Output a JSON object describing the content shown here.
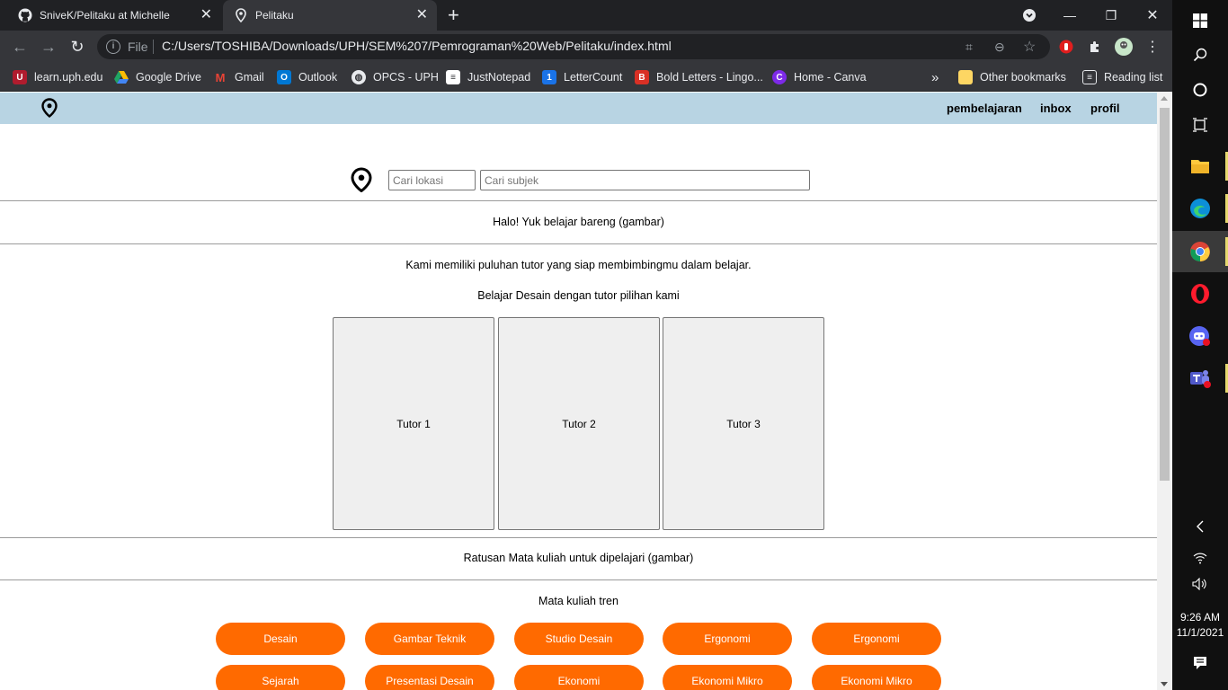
{
  "browser": {
    "tabs": [
      {
        "title": "SniveK/Pelitaku at Michelle",
        "icon": "github-icon"
      },
      {
        "title": "Pelitaku",
        "icon": "location-pin-icon"
      }
    ],
    "address": {
      "scheme_label": "File",
      "url": "C:/Users/TOSHIBA/Downloads/UPH/SEM%207/Pemrograman%20Web/Pelitaku/index.html"
    },
    "bookmarks": [
      {
        "label": "learn.uph.edu",
        "color": "#b01c2e"
      },
      {
        "label": "Google Drive",
        "color": "#1fa463"
      },
      {
        "label": "Gmail",
        "color": "#ea4335"
      },
      {
        "label": "Outlook",
        "color": "#0078d4"
      },
      {
        "label": "OPCS - UPH",
        "color": "#5f6368"
      },
      {
        "label": "JustNotepad",
        "color": "#ffffff"
      },
      {
        "label": "LetterCount",
        "color": "#1a73e8"
      },
      {
        "label": "Bold Letters - Lingo...",
        "color": "#d93025"
      },
      {
        "label": "Home - Canva",
        "color": "#7d2ae8"
      }
    ],
    "overflow_label": "»",
    "other_bookmarks": "Other bookmarks",
    "reading_list": "Reading list"
  },
  "site": {
    "nav": {
      "links": [
        "pembelajaran",
        "inbox",
        "profil"
      ]
    },
    "search": {
      "location_placeholder": "Cari lokasi",
      "subject_placeholder": "Cari subjek"
    },
    "hero_text": "Halo! Yuk belajar bareng (gambar)",
    "intro_text": "Kami memiliki puluhan tutor yang siap membimbingmu dalam belajar.",
    "tutor_heading": "Belajar Desain dengan tutor pilihan kami",
    "tutors": [
      "Tutor 1",
      "Tutor 2",
      "Tutor 3"
    ],
    "courses_banner": "Ratusan Mata kuliah untuk dipelajari (gambar)",
    "trending_heading": "Mata kuliah tren",
    "trending": [
      "Desain",
      "Gambar Teknik",
      "Studio Desain",
      "Ergonomi",
      "Ergonomi",
      "Sejarah",
      "Presentasi Desain",
      "Ekonomi",
      "Ekonomi Mikro",
      "Ekonomi Mikro"
    ],
    "accent_color": "#ff6a00",
    "nav_color": "#b8d4e3"
  },
  "taskbar": {
    "time": "9:26 AM",
    "date": "11/1/2021"
  }
}
